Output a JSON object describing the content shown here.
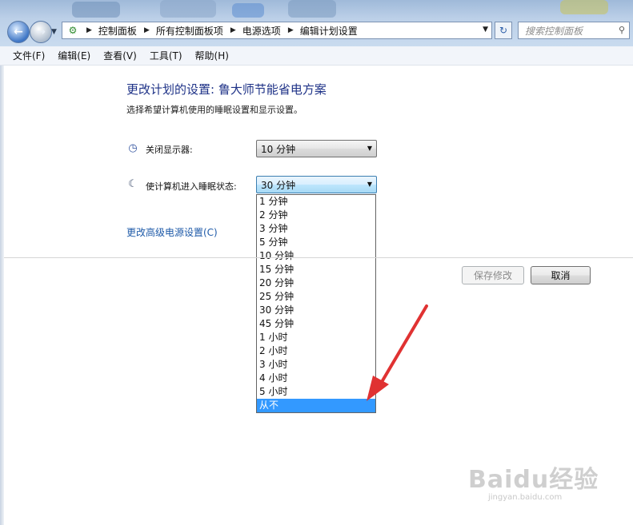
{
  "address_bar": {
    "breadcrumbs": [
      "控制面板",
      "所有控制面板项",
      "电源选项",
      "编辑计划设置"
    ]
  },
  "search": {
    "placeholder": "搜索控制面板"
  },
  "menu": [
    "文件(F)",
    "编辑(E)",
    "查看(V)",
    "工具(T)",
    "帮助(H)"
  ],
  "page": {
    "title": "更改计划的设置: 鲁大师节能省电方案",
    "subtitle": "选择希望计算机使用的睡眠设置和显示设置。"
  },
  "settings": {
    "display": {
      "label": "关闭显示器:",
      "value": "10 分钟"
    },
    "sleep": {
      "label": "使计算机进入睡眠状态:",
      "value": "30 分钟"
    }
  },
  "sleep_options": [
    "1 分钟",
    "2 分钟",
    "3 分钟",
    "5 分钟",
    "10 分钟",
    "15 分钟",
    "20 分钟",
    "25 分钟",
    "30 分钟",
    "45 分钟",
    "1 小时",
    "2 小时",
    "3 小时",
    "4 小时",
    "5 小时",
    "从不"
  ],
  "sleep_highlighted": "从不",
  "advanced_link": "更改高级电源设置(C)",
  "buttons": {
    "save": "保存修改",
    "cancel": "取消"
  },
  "watermark": {
    "logo": "Baidu经验",
    "url": "jingyan.baidu.com"
  },
  "colors": {
    "title": "#1e3287",
    "link": "#1e5aa8",
    "highlight": "#3399ff",
    "arrow": "#e03232"
  },
  "icons": {
    "back": "back-arrow-icon",
    "forward": "forward-arrow-icon",
    "control_panel": "control-panel-icon",
    "refresh": "refresh-icon",
    "search": "search-icon",
    "display": "display-clock-icon",
    "sleep": "moon-icon"
  }
}
